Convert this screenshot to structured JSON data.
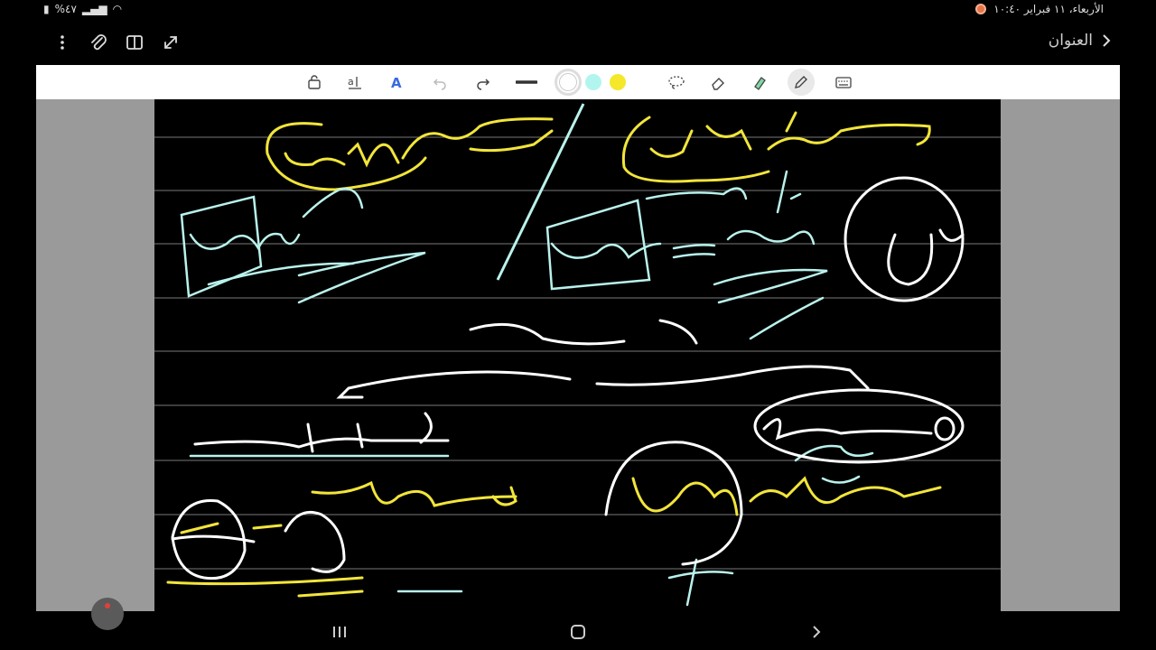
{
  "status": {
    "battery": "%٤٧",
    "datetime": "الأربعاء، ١١ فبراير ١٠:٤٠"
  },
  "header": {
    "title": "العنوان",
    "icons": [
      "more-icon",
      "attach-icon",
      "book-icon",
      "expand-icon"
    ]
  },
  "toolbar": {
    "items": [
      "lock-icon",
      "text-size-icon",
      "text-color-icon",
      "undo-icon",
      "redo-icon",
      "line-icon",
      "color-white",
      "color-cyan",
      "color-yellow",
      "lasso-icon",
      "eraser-icon",
      "highlighter-icon",
      "pen-icon",
      "keyboard-icon"
    ],
    "colors": {
      "white": "#ffffff",
      "cyan": "#b2f5ee",
      "yellow": "#f5e72a"
    },
    "selected_color": "white",
    "active_tool": "pen-icon"
  },
  "canvas": {
    "background": "#000000",
    "ink_colors": {
      "white": "#ffffff",
      "cyan": "#b9f2ec",
      "yellow": "#f2e53a"
    }
  },
  "navbar": {
    "items": [
      "recent-apps-icon",
      "home-icon",
      "back-icon"
    ]
  }
}
